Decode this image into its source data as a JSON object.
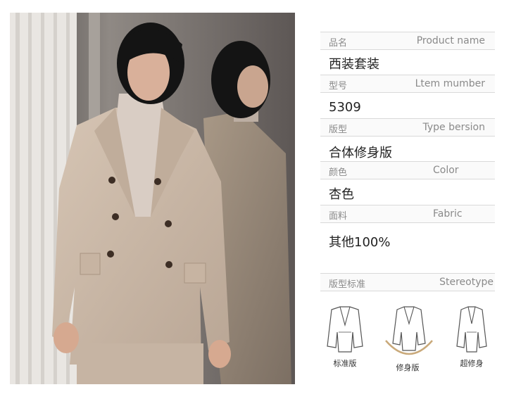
{
  "product": {
    "rows": [
      {
        "cn": "品名",
        "en": "Product name",
        "value": "西装套装"
      },
      {
        "cn": "型号",
        "en": "Ltem mumber",
        "value": "5309"
      },
      {
        "cn": "版型",
        "en": "Type bersion",
        "value": "合体修身版"
      },
      {
        "cn": "颜色",
        "en": "Color",
        "value": "杏色"
      },
      {
        "cn": "面料",
        "en": "Fabric",
        "value": "其他100%"
      }
    ],
    "stereotype": {
      "cn": "版型标准",
      "en": "Stereotype"
    },
    "fits": [
      "标准版",
      "修身版",
      "超修身"
    ],
    "selected_fit": "修身版"
  },
  "colors": {
    "blazer": "#cbb9a8",
    "turtleneck": "#d9cdc4",
    "hair": "#141414",
    "selected_arc": "#c9a97a"
  }
}
